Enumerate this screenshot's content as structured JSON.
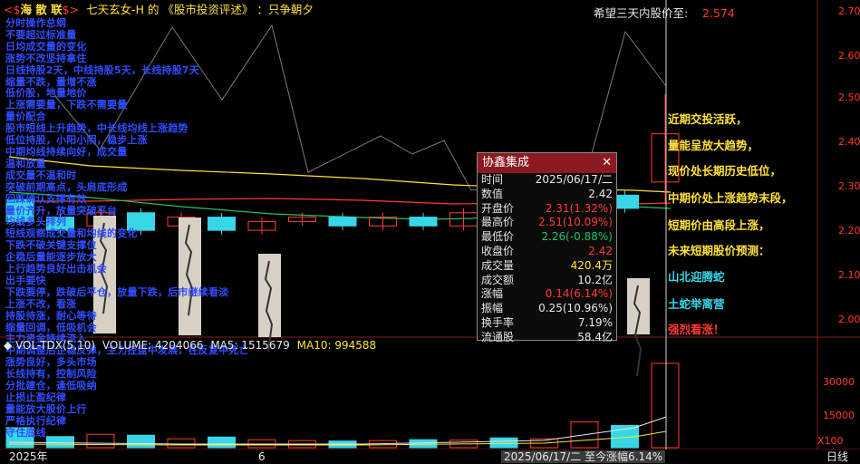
{
  "header": {
    "logo_text": "海 散 联",
    "logo_marks": [
      "<$",
      "$>"
    ],
    "subtitle_prefix": "七天玄女-H 的 《股市投资评述》 ：只争朝夕",
    "target_label": "希望三天内股价至:",
    "target_value": "2.574"
  },
  "price_axis": [
    "2.70",
    "2.60",
    "2.50",
    "2.40",
    "2.30",
    "2.20",
    "2.10",
    "2.00"
  ],
  "overlay_lines": [
    "分时操作总纲",
    "不要超过标准量",
    "日均成交量的变化",
    "涨势不改坚持拿住",
    "日线持股2天，中线持股5天，长线持股7天",
    "缩量不跌，量增不涨",
    "低价股，地量地价",
    "上涨需要量，下跌不需要量",
    "量价配合",
    "股市短线上升趋势，中长线均线上涨趋势",
    "低位持股，小阳小阴，稳步上涨",
    "中期均线持续向好，成交量",
    "温和放量",
    "成交量不温和时",
    "突破前期高点，头肩底形成",
    "回踩确认支撑有效",
    "量价齐升，放量突破平台",
    "均线多头排列",
    "短线观察成交量和均线的变化",
    "下跌不破关键支撑位",
    "企稳后量能逐步放大",
    "上行趋势良好出击机会",
    "出手要快",
    "下跌要停，跌破后平仓，放量下跌，后市继续看淡",
    "上涨不改，看涨",
    "持股待涨，耐心等待",
    "缩量回调，低吸机会",
    "主力资金持续流入",
    "中期调整后企稳反弹，主力控盘中发展，在反复中死亡",
    "涨势良好，多头市场",
    "长线持有，控制风险",
    "分批建仓，逢低吸纳",
    "止损止盈纪律",
    "量能放大股价上行",
    "严格执行纪律",
    "守住底线"
  ],
  "popup": {
    "title": "协鑫集成",
    "rows": [
      {
        "k": "时间",
        "v": "2025/06/17/二",
        "c": "white"
      },
      {
        "k": "数值",
        "v": "2.42",
        "c": "white"
      },
      {
        "k": "开盘价",
        "v": "2.31(1.32%)",
        "c": "red"
      },
      {
        "k": "最高价",
        "v": "2.51(10.09%)",
        "c": "red"
      },
      {
        "k": "最低价",
        "v": "2.26(-0.88%)",
        "c": "green"
      },
      {
        "k": "收盘价",
        "v": "2.42",
        "c": "red"
      },
      {
        "k": "成交量",
        "v": "420.4万",
        "c": "yellow"
      },
      {
        "k": "成交额",
        "v": "10.2亿",
        "c": "white"
      },
      {
        "k": "涨幅",
        "v": "0.14(6.14%)",
        "c": "red"
      },
      {
        "k": "振幅",
        "v": "0.25(10.96%)",
        "c": "white"
      },
      {
        "k": "换手率",
        "v": "7.19%",
        "c": "white"
      },
      {
        "k": "流通股",
        "v": "58.4亿",
        "c": "white"
      }
    ]
  },
  "commentary": [
    {
      "text": "近期交投活跃，",
      "color": "#ffe23a"
    },
    {
      "text": "量能呈放大趋势，",
      "color": "#ffe23a"
    },
    {
      "text": "现价处长期历史低位，",
      "color": "#ffe23a"
    },
    {
      "text": "中期价处上涨趋势末段，",
      "color": "#ffe23a"
    },
    {
      "text": "短期价由高段上涨，",
      "color": "#ffe23a"
    },
    {
      "text": "未来短期股价预测：",
      "color": "#ffe23a"
    },
    {
      "text": "山北迎腾蛇",
      "color": "#37d7e8"
    },
    {
      "text": "土蛇举离营",
      "color": "#37d7e8"
    },
    {
      "text": "强烈看涨！",
      "color": "#ff3b30"
    }
  ],
  "volume_header": {
    "label": "VOL-TDX(5,10)",
    "volume": "VOLUME: 4204066",
    "ma5": "MA5: 1515679",
    "ma10": "MA10: 994588"
  },
  "volume_axis": [
    "30000",
    "15000",
    "X100"
  ],
  "bottom": {
    "year": "2025年",
    "month": "6",
    "cursor_label": "2025/06/17/二 至今涨幅6.14%",
    "period": "日线"
  },
  "colors": {
    "up": "#ff3b30",
    "down": "#37d7e8",
    "ma_yellow": "#ffe23a",
    "ma_green": "#22c55e",
    "ma_red": "#ff3b30",
    "bg": "#000000"
  },
  "candles": [
    {
      "o": 2.27,
      "c": 2.22,
      "h": 2.28,
      "l": 2.21,
      "v": 4.5
    },
    {
      "o": 2.23,
      "c": 2.2,
      "h": 2.24,
      "l": 2.19,
      "v": 2.5
    },
    {
      "o": 2.21,
      "c": 2.24,
      "h": 2.25,
      "l": 2.2,
      "v": 3.0
    },
    {
      "o": 2.24,
      "c": 2.2,
      "h": 2.25,
      "l": 2.19,
      "v": 2.8
    },
    {
      "o": 2.21,
      "c": 2.23,
      "h": 2.24,
      "l": 2.2,
      "v": 2.0
    },
    {
      "o": 2.23,
      "c": 2.2,
      "h": 2.24,
      "l": 2.19,
      "v": 2.4
    },
    {
      "o": 2.2,
      "c": 2.22,
      "h": 2.23,
      "l": 2.19,
      "v": 1.8
    },
    {
      "o": 2.22,
      "c": 2.23,
      "h": 2.24,
      "l": 2.21,
      "v": 1.6
    },
    {
      "o": 2.23,
      "c": 2.21,
      "h": 2.24,
      "l": 2.2,
      "v": 1.5
    },
    {
      "o": 2.21,
      "c": 2.23,
      "h": 2.24,
      "l": 2.2,
      "v": 1.6
    },
    {
      "o": 2.23,
      "c": 2.21,
      "h": 2.24,
      "l": 2.2,
      "v": 1.8
    },
    {
      "o": 2.21,
      "c": 2.24,
      "h": 2.25,
      "l": 2.2,
      "v": 1.7
    },
    {
      "o": 2.24,
      "c": 2.21,
      "h": 2.25,
      "l": 2.2,
      "v": 2.2
    },
    {
      "o": 2.21,
      "c": 2.23,
      "h": 2.24,
      "l": 2.2,
      "v": 2.0
    },
    {
      "o": 2.23,
      "c": 2.28,
      "h": 2.29,
      "l": 2.22,
      "v": 5.8
    },
    {
      "o": 2.28,
      "c": 2.25,
      "h": 2.29,
      "l": 2.24,
      "v": 5.0
    },
    {
      "o": 2.31,
      "c": 2.42,
      "h": 2.51,
      "l": 2.26,
      "v": 19.0
    }
  ]
}
